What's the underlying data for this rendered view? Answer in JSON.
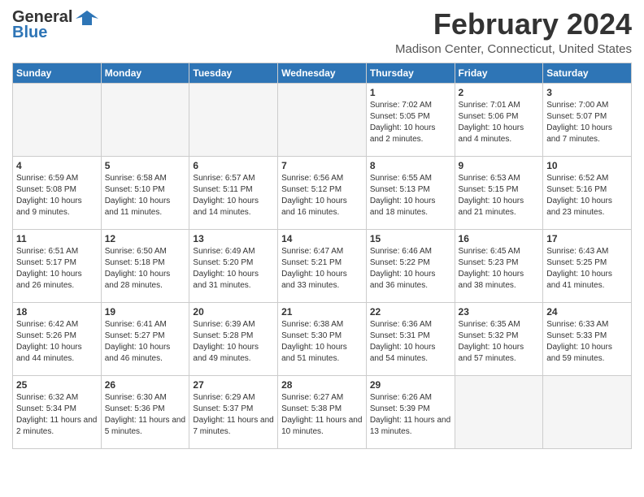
{
  "header": {
    "logo_general": "General",
    "logo_blue": "Blue",
    "month_title": "February 2024",
    "location": "Madison Center, Connecticut, United States"
  },
  "weekdays": [
    "Sunday",
    "Monday",
    "Tuesday",
    "Wednesday",
    "Thursday",
    "Friday",
    "Saturday"
  ],
  "weeks": [
    [
      {
        "day": "",
        "empty": true
      },
      {
        "day": "",
        "empty": true
      },
      {
        "day": "",
        "empty": true
      },
      {
        "day": "",
        "empty": true
      },
      {
        "day": "1",
        "sunrise": "Sunrise: 7:02 AM",
        "sunset": "Sunset: 5:05 PM",
        "daylight": "Daylight: 10 hours and 2 minutes."
      },
      {
        "day": "2",
        "sunrise": "Sunrise: 7:01 AM",
        "sunset": "Sunset: 5:06 PM",
        "daylight": "Daylight: 10 hours and 4 minutes."
      },
      {
        "day": "3",
        "sunrise": "Sunrise: 7:00 AM",
        "sunset": "Sunset: 5:07 PM",
        "daylight": "Daylight: 10 hours and 7 minutes."
      }
    ],
    [
      {
        "day": "4",
        "sunrise": "Sunrise: 6:59 AM",
        "sunset": "Sunset: 5:08 PM",
        "daylight": "Daylight: 10 hours and 9 minutes."
      },
      {
        "day": "5",
        "sunrise": "Sunrise: 6:58 AM",
        "sunset": "Sunset: 5:10 PM",
        "daylight": "Daylight: 10 hours and 11 minutes."
      },
      {
        "day": "6",
        "sunrise": "Sunrise: 6:57 AM",
        "sunset": "Sunset: 5:11 PM",
        "daylight": "Daylight: 10 hours and 14 minutes."
      },
      {
        "day": "7",
        "sunrise": "Sunrise: 6:56 AM",
        "sunset": "Sunset: 5:12 PM",
        "daylight": "Daylight: 10 hours and 16 minutes."
      },
      {
        "day": "8",
        "sunrise": "Sunrise: 6:55 AM",
        "sunset": "Sunset: 5:13 PM",
        "daylight": "Daylight: 10 hours and 18 minutes."
      },
      {
        "day": "9",
        "sunrise": "Sunrise: 6:53 AM",
        "sunset": "Sunset: 5:15 PM",
        "daylight": "Daylight: 10 hours and 21 minutes."
      },
      {
        "day": "10",
        "sunrise": "Sunrise: 6:52 AM",
        "sunset": "Sunset: 5:16 PM",
        "daylight": "Daylight: 10 hours and 23 minutes."
      }
    ],
    [
      {
        "day": "11",
        "sunrise": "Sunrise: 6:51 AM",
        "sunset": "Sunset: 5:17 PM",
        "daylight": "Daylight: 10 hours and 26 minutes."
      },
      {
        "day": "12",
        "sunrise": "Sunrise: 6:50 AM",
        "sunset": "Sunset: 5:18 PM",
        "daylight": "Daylight: 10 hours and 28 minutes."
      },
      {
        "day": "13",
        "sunrise": "Sunrise: 6:49 AM",
        "sunset": "Sunset: 5:20 PM",
        "daylight": "Daylight: 10 hours and 31 minutes."
      },
      {
        "day": "14",
        "sunrise": "Sunrise: 6:47 AM",
        "sunset": "Sunset: 5:21 PM",
        "daylight": "Daylight: 10 hours and 33 minutes."
      },
      {
        "day": "15",
        "sunrise": "Sunrise: 6:46 AM",
        "sunset": "Sunset: 5:22 PM",
        "daylight": "Daylight: 10 hours and 36 minutes."
      },
      {
        "day": "16",
        "sunrise": "Sunrise: 6:45 AM",
        "sunset": "Sunset: 5:23 PM",
        "daylight": "Daylight: 10 hours and 38 minutes."
      },
      {
        "day": "17",
        "sunrise": "Sunrise: 6:43 AM",
        "sunset": "Sunset: 5:25 PM",
        "daylight": "Daylight: 10 hours and 41 minutes."
      }
    ],
    [
      {
        "day": "18",
        "sunrise": "Sunrise: 6:42 AM",
        "sunset": "Sunset: 5:26 PM",
        "daylight": "Daylight: 10 hours and 44 minutes."
      },
      {
        "day": "19",
        "sunrise": "Sunrise: 6:41 AM",
        "sunset": "Sunset: 5:27 PM",
        "daylight": "Daylight: 10 hours and 46 minutes."
      },
      {
        "day": "20",
        "sunrise": "Sunrise: 6:39 AM",
        "sunset": "Sunset: 5:28 PM",
        "daylight": "Daylight: 10 hours and 49 minutes."
      },
      {
        "day": "21",
        "sunrise": "Sunrise: 6:38 AM",
        "sunset": "Sunset: 5:30 PM",
        "daylight": "Daylight: 10 hours and 51 minutes."
      },
      {
        "day": "22",
        "sunrise": "Sunrise: 6:36 AM",
        "sunset": "Sunset: 5:31 PM",
        "daylight": "Daylight: 10 hours and 54 minutes."
      },
      {
        "day": "23",
        "sunrise": "Sunrise: 6:35 AM",
        "sunset": "Sunset: 5:32 PM",
        "daylight": "Daylight: 10 hours and 57 minutes."
      },
      {
        "day": "24",
        "sunrise": "Sunrise: 6:33 AM",
        "sunset": "Sunset: 5:33 PM",
        "daylight": "Daylight: 10 hours and 59 minutes."
      }
    ],
    [
      {
        "day": "25",
        "sunrise": "Sunrise: 6:32 AM",
        "sunset": "Sunset: 5:34 PM",
        "daylight": "Daylight: 11 hours and 2 minutes."
      },
      {
        "day": "26",
        "sunrise": "Sunrise: 6:30 AM",
        "sunset": "Sunset: 5:36 PM",
        "daylight": "Daylight: 11 hours and 5 minutes."
      },
      {
        "day": "27",
        "sunrise": "Sunrise: 6:29 AM",
        "sunset": "Sunset: 5:37 PM",
        "daylight": "Daylight: 11 hours and 7 minutes."
      },
      {
        "day": "28",
        "sunrise": "Sunrise: 6:27 AM",
        "sunset": "Sunset: 5:38 PM",
        "daylight": "Daylight: 11 hours and 10 minutes."
      },
      {
        "day": "29",
        "sunrise": "Sunrise: 6:26 AM",
        "sunset": "Sunset: 5:39 PM",
        "daylight": "Daylight: 11 hours and 13 minutes."
      },
      {
        "day": "",
        "empty": true
      },
      {
        "day": "",
        "empty": true
      }
    ]
  ]
}
